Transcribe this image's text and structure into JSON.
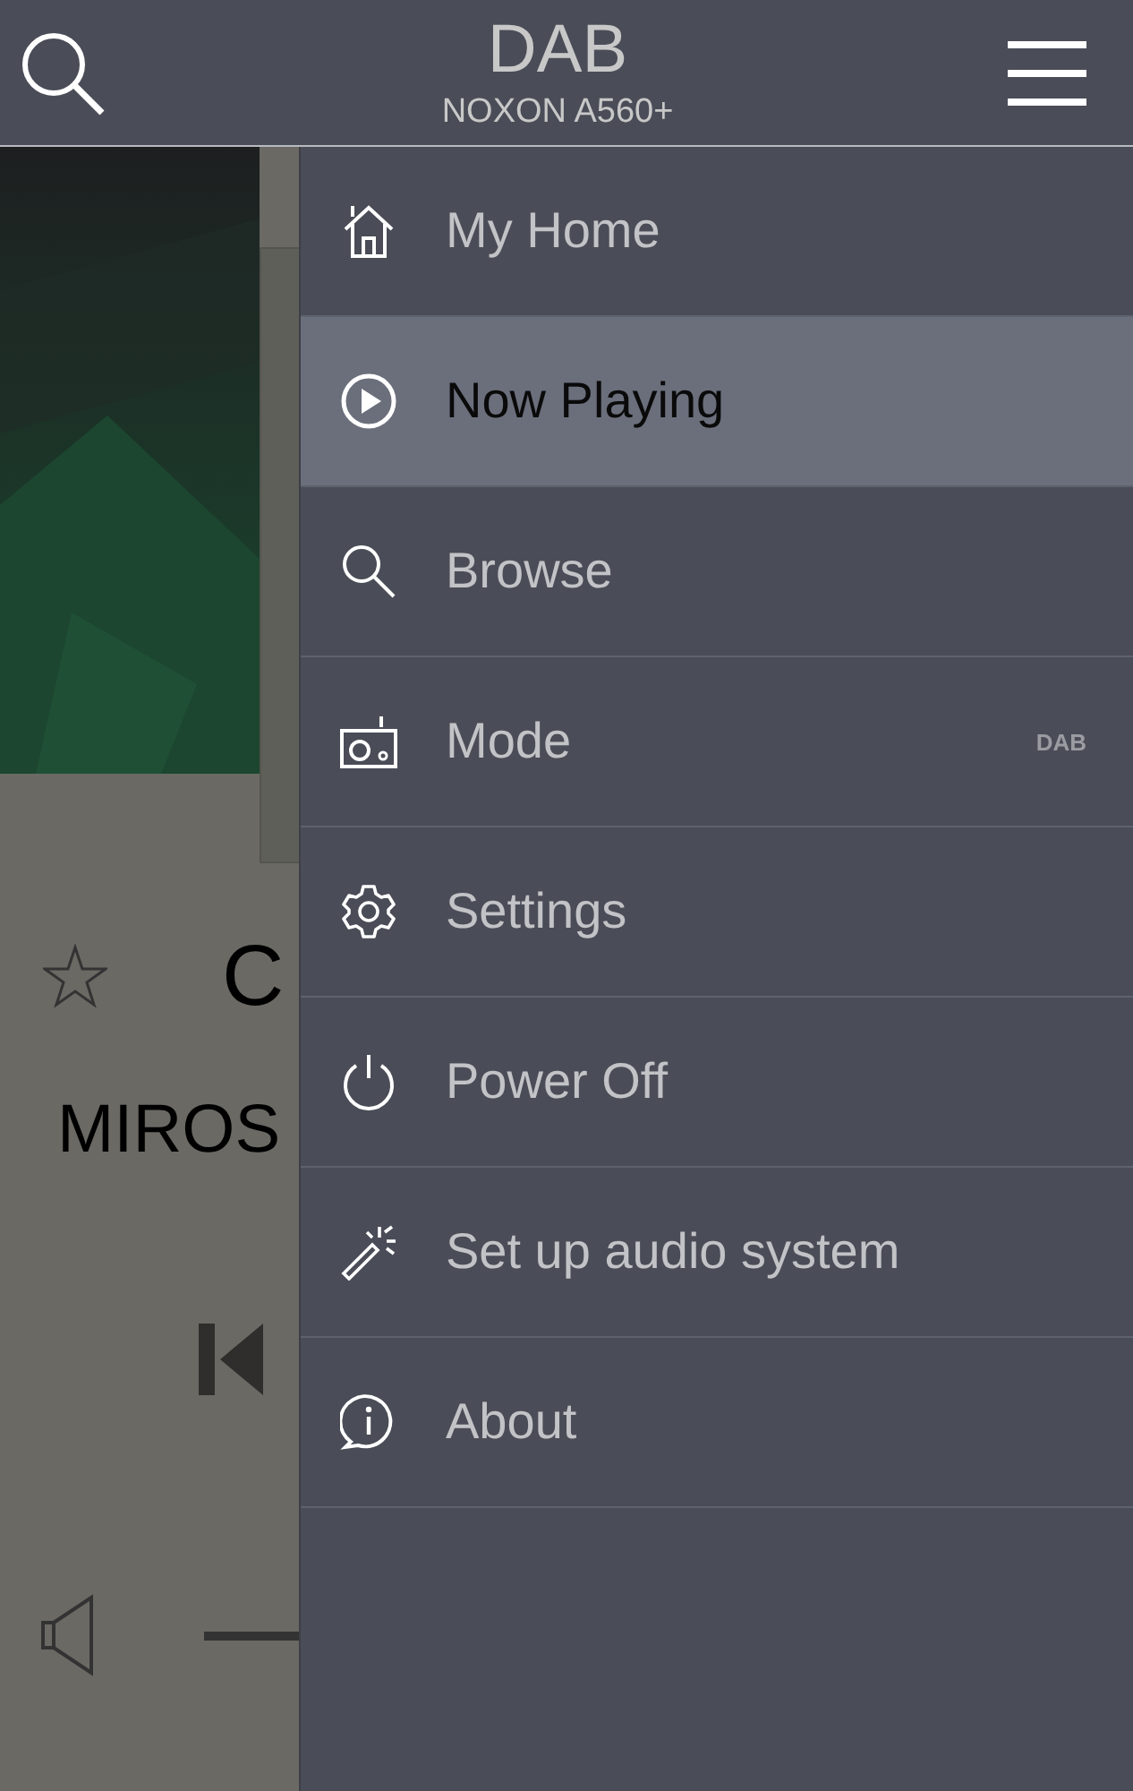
{
  "header": {
    "title": "DAB",
    "subtitle": "NOXON A560+"
  },
  "player": {
    "track_title": "C",
    "artist": "MIROS"
  },
  "drawer": {
    "items": [
      {
        "kind": "home",
        "label": "My Home",
        "selected": false
      },
      {
        "kind": "play",
        "label": "Now Playing",
        "selected": true
      },
      {
        "kind": "search",
        "label": "Browse",
        "selected": false
      },
      {
        "kind": "radio",
        "label": "Mode",
        "selected": false,
        "badge": "DAB"
      },
      {
        "kind": "gear",
        "label": "Settings",
        "selected": false
      },
      {
        "kind": "power",
        "label": "Power Off",
        "selected": false
      },
      {
        "kind": "wand",
        "label": "Set up audio system",
        "selected": false
      },
      {
        "kind": "info",
        "label": "About",
        "selected": false
      }
    ]
  }
}
